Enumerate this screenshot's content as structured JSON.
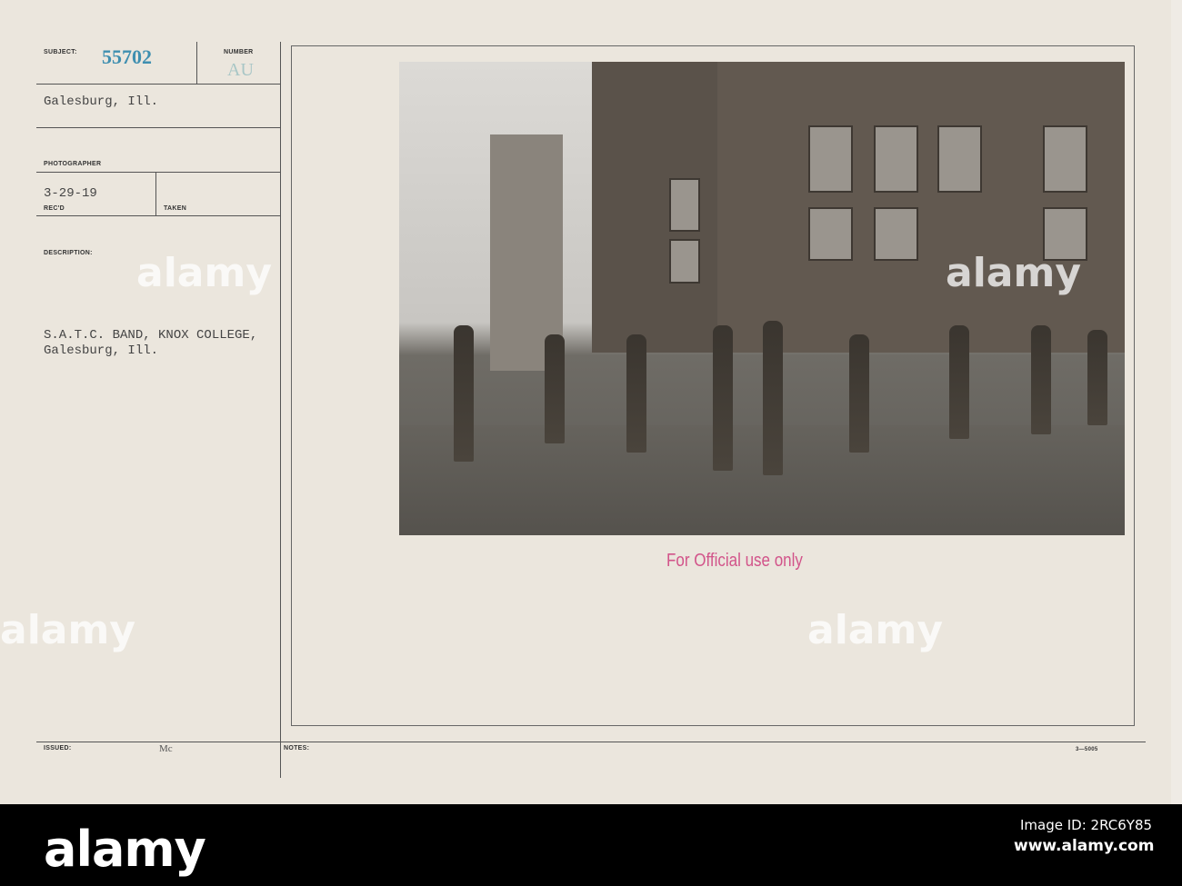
{
  "card": {
    "subject_label": "SUBJECT:",
    "subject_number": "55702",
    "number_label": "NUMBER",
    "number_value": "AU",
    "location": "Galesburg, Ill.",
    "photographer_label": "PHOTOGRAPHER",
    "received_date": "3-29-19",
    "received_label": "REC'D",
    "taken_label": "TAKEN",
    "description_label": "DESCRIPTION:",
    "description_line1": "S.A.T.C. BAND, KNOX COLLEGE,",
    "description_line2": "Galesburg, Ill.",
    "issued_label": "ISSUED:",
    "issued_value": "Mc",
    "notes_label": "NOTES:",
    "form_number": "3—5005",
    "stamp": "For Official use only"
  },
  "watermark": {
    "logo": "alamy",
    "image_id": "Image ID: 2RC6Y85",
    "url": "www.alamy.com"
  }
}
